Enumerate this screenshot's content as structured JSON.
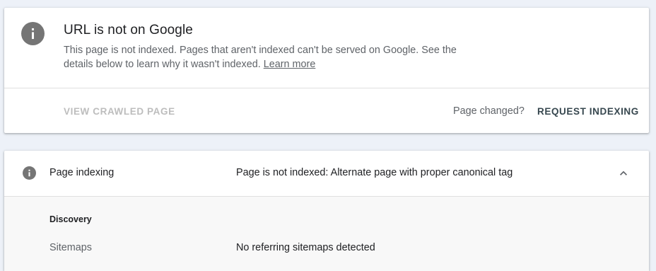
{
  "status_card": {
    "icon": "info-icon",
    "title": "URL is not on Google",
    "description": "This page is not indexed. Pages that aren't indexed can't be served on Google. See the details below to learn why it wasn't indexed.",
    "learn_more": "Learn more",
    "view_crawled_label": "VIEW CRAWLED PAGE",
    "page_changed_text": "Page changed?",
    "request_indexing_label": "REQUEST INDEXING"
  },
  "indexing_card": {
    "icon": "info-icon",
    "label": "Page indexing",
    "value": "Page is not indexed: Alternate page with proper canonical tag",
    "expanded_icon": "chevron-up-icon",
    "section_title": "Discovery",
    "rows": [
      {
        "label": "Sitemaps",
        "value": "No referring sitemaps detected"
      }
    ]
  },
  "colors": {
    "page_background": "#edf1f8",
    "icon_gray": "#757575",
    "disabled_action": "#bdbdbd",
    "primary_action": "#37474f"
  }
}
